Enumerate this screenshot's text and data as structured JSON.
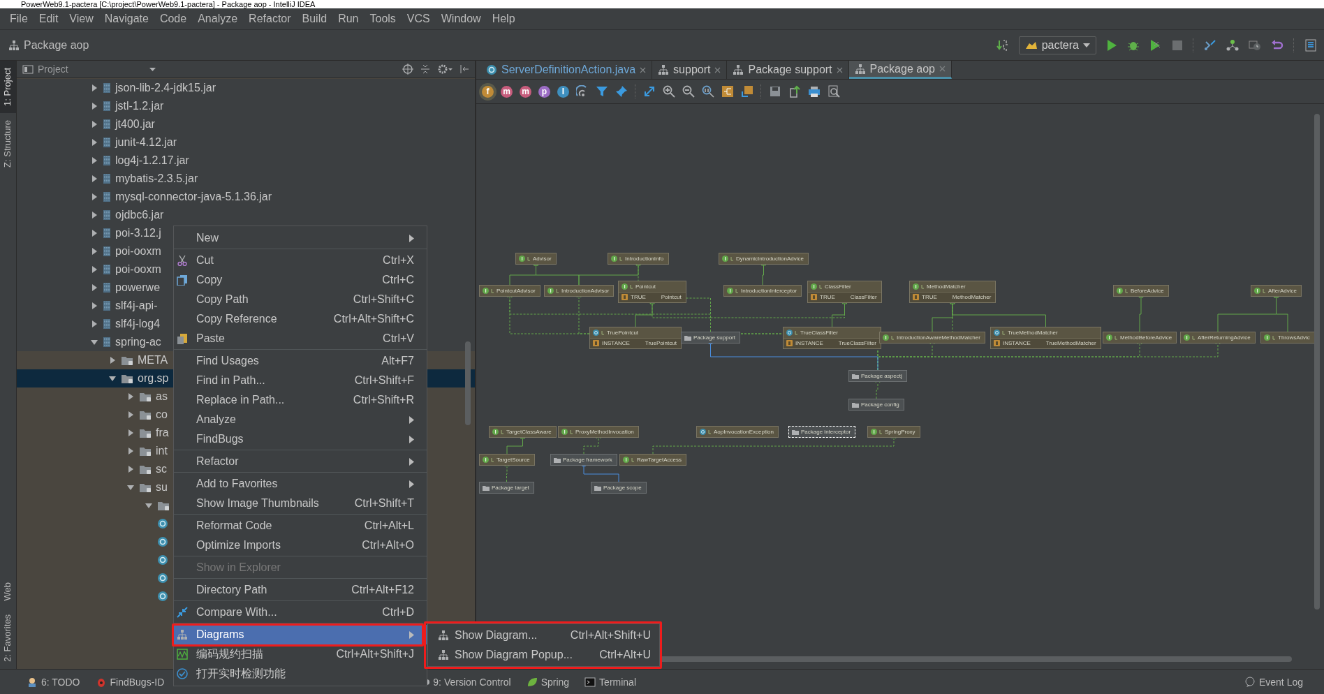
{
  "window": {
    "title": "PowerWeb9.1-pactera [C:\\project\\PowerWeb9.1-pactera] - Package aop - IntelliJ IDEA"
  },
  "menu_bar": [
    "File",
    "Edit",
    "View",
    "Navigate",
    "Code",
    "Analyze",
    "Refactor",
    "Build",
    "Run",
    "Tools",
    "VCS",
    "Window",
    "Help"
  ],
  "nav_bar": {
    "breadcrumb": "Package aop",
    "run_config": "pactera"
  },
  "side_tabs": {
    "top": [
      {
        "label": "1: Project",
        "selected": true
      },
      {
        "label": "Z: Structure",
        "selected": false
      }
    ],
    "bottom": [
      {
        "label": "Web",
        "selected": false
      },
      {
        "label": "2: Favorites",
        "selected": false
      }
    ]
  },
  "project_panel": {
    "title": "Project",
    "tree": [
      {
        "label": "json-lib-2.4-jdk15.jar",
        "kind": "jar",
        "expanded": false,
        "selected": false,
        "tinted": false
      },
      {
        "label": "jstl-1.2.jar",
        "kind": "jar",
        "expanded": false,
        "selected": false,
        "tinted": false
      },
      {
        "label": "jt400.jar",
        "kind": "jar",
        "expanded": false,
        "selected": false,
        "tinted": false
      },
      {
        "label": "junit-4.12.jar",
        "kind": "jar",
        "expanded": false,
        "selected": false,
        "tinted": false
      },
      {
        "label": "log4j-1.2.17.jar",
        "kind": "jar",
        "expanded": false,
        "selected": false,
        "tinted": false
      },
      {
        "label": "mybatis-2.3.5.jar",
        "kind": "jar",
        "expanded": false,
        "selected": false,
        "tinted": false
      },
      {
        "label": "mysql-connector-java-5.1.36.jar",
        "kind": "jar",
        "expanded": false,
        "selected": false,
        "tinted": false
      },
      {
        "label": "ojdbc6.jar",
        "kind": "jar",
        "expanded": false,
        "selected": false,
        "tinted": false
      },
      {
        "label": "poi-3.12.j",
        "kind": "jar",
        "expanded": false,
        "selected": false,
        "tinted": false
      },
      {
        "label": "poi-ooxm",
        "kind": "jar",
        "expanded": false,
        "selected": false,
        "tinted": false
      },
      {
        "label": "poi-ooxm",
        "kind": "jar",
        "expanded": false,
        "selected": false,
        "tinted": false
      },
      {
        "label": "powerwe",
        "kind": "jar",
        "expanded": false,
        "selected": false,
        "tinted": false
      },
      {
        "label": "slf4j-api-",
        "kind": "jar",
        "expanded": false,
        "selected": false,
        "tinted": false
      },
      {
        "label": "slf4j-log4",
        "kind": "jar",
        "expanded": false,
        "selected": false,
        "tinted": false
      },
      {
        "label": "spring-ac",
        "kind": "jar",
        "expanded": true,
        "selected": false,
        "tinted": false,
        "children": [
          {
            "label": "META",
            "kind": "folder",
            "expanded": false,
            "selected": false,
            "tinted": true
          },
          {
            "label": "org.sp",
            "kind": "folder",
            "expanded": true,
            "selected": true,
            "tinted": true,
            "children": [
              {
                "label": "as",
                "kind": "folder",
                "expanded": false,
                "selected": false,
                "tinted": true
              },
              {
                "label": "co",
                "kind": "folder",
                "expanded": false,
                "selected": false,
                "tinted": true
              },
              {
                "label": "fra",
                "kind": "folder",
                "expanded": false,
                "selected": false,
                "tinted": true
              },
              {
                "label": "int",
                "kind": "folder",
                "expanded": false,
                "selected": false,
                "tinted": true
              },
              {
                "label": "sc",
                "kind": "folder",
                "expanded": false,
                "selected": false,
                "tinted": true
              },
              {
                "label": "su",
                "kind": "folder",
                "expanded": true,
                "selected": false,
                "tinted": true,
                "children": [
                  {
                    "kind": "folder",
                    "expanded": true,
                    "selected": false,
                    "tinted": true
                  },
                  {
                    "kind": "class",
                    "selected": false,
                    "tinted": true
                  },
                  {
                    "kind": "class",
                    "selected": false,
                    "tinted": true
                  },
                  {
                    "kind": "class",
                    "selected": false,
                    "tinted": true
                  },
                  {
                    "kind": "class",
                    "selected": false,
                    "tinted": true
                  },
                  {
                    "kind": "class",
                    "selected": false,
                    "tinted": true
                  }
                ]
              }
            ]
          }
        ]
      }
    ]
  },
  "editor_tabs": [
    {
      "label": "ServerDefinitionAction.java",
      "kind": "class",
      "selected": false
    },
    {
      "label": "support",
      "kind": "diagram",
      "selected": false
    },
    {
      "label": "Package support",
      "kind": "diagram",
      "selected": false
    },
    {
      "label": "Package aop",
      "kind": "diagram",
      "selected": true
    }
  ],
  "diagram_toolbar": {
    "badges": [
      {
        "letter": "f",
        "color": "#c08b37",
        "selected": true
      },
      {
        "letter": "m",
        "color": "#c65c7c",
        "selected": false
      },
      {
        "letter": "m",
        "color": "#c65c7c",
        "selected": false
      },
      {
        "letter": "p",
        "color": "#9b6cc4",
        "selected": false
      },
      {
        "letter": "I",
        "color": "#3e8fbf",
        "selected": false
      }
    ]
  },
  "diagram": {
    "nodes": [
      {
        "name": "Advisor",
        "kind": "interface",
        "selected": false
      },
      {
        "name": "IntroductionInfo",
        "kind": "interface",
        "selected": false
      },
      {
        "name": "DynamicIntroductionAdvice",
        "kind": "interface",
        "selected": false
      },
      {
        "name": "PointcutAdvisor",
        "kind": "interface",
        "selected": false
      },
      {
        "name": "IntroductionAdvisor",
        "kind": "interface",
        "selected": false
      },
      {
        "name": "Pointcut",
        "kind": "interface",
        "selected": false,
        "fields": [
          {
            "name": "TRUE",
            "type": "Pointcut"
          }
        ]
      },
      {
        "name": "IntroductionInterceptor",
        "kind": "interface",
        "selected": false
      },
      {
        "name": "ClassFilter",
        "kind": "interface",
        "selected": false,
        "fields": [
          {
            "name": "TRUE",
            "type": "ClassFilter"
          }
        ]
      },
      {
        "name": "MethodMatcher",
        "kind": "interface",
        "selected": false,
        "fields": [
          {
            "name": "TRUE",
            "type": "MethodMatcher"
          }
        ]
      },
      {
        "name": "BeforeAdvice",
        "kind": "interface",
        "selected": false
      },
      {
        "name": "AfterAdvice",
        "kind": "interface",
        "selected": false
      },
      {
        "name": "TruePointcut",
        "kind": "class",
        "selected": false,
        "fields": [
          {
            "name": "INSTANCE",
            "type": "TruePointcut"
          }
        ]
      },
      {
        "name": "Package support",
        "kind": "package",
        "selected": false
      },
      {
        "name": "TrueClassFilter",
        "kind": "class",
        "selected": false,
        "fields": [
          {
            "name": "INSTANCE",
            "type": "TrueClassFilter"
          }
        ]
      },
      {
        "name": "IntroductionAwareMethodMatcher",
        "kind": "interface",
        "selected": false
      },
      {
        "name": "TrueMethodMatcher",
        "kind": "class",
        "selected": false,
        "fields": [
          {
            "name": "INSTANCE",
            "type": "TrueMethodMatcher"
          }
        ]
      },
      {
        "name": "MethodBeforeAdvice",
        "kind": "interface",
        "selected": false
      },
      {
        "name": "AfterReturningAdvice",
        "kind": "interface",
        "selected": false
      },
      {
        "name": "ThrowsAdvic",
        "kind": "interface",
        "selected": false
      },
      {
        "name": "Package aspectj",
        "kind": "package",
        "selected": false
      },
      {
        "name": "Package config",
        "kind": "package",
        "selected": false
      },
      {
        "name": "TargetClassAware",
        "kind": "interface",
        "selected": false
      },
      {
        "name": "ProxyMethodInvocation",
        "kind": "interface",
        "selected": false
      },
      {
        "name": "AopInvocationException",
        "kind": "class",
        "selected": false
      },
      {
        "name": "Package interceptor",
        "kind": "package",
        "selected": true
      },
      {
        "name": "SpringProxy",
        "kind": "interface",
        "selected": false
      },
      {
        "name": "TargetSource",
        "kind": "interface",
        "selected": false
      },
      {
        "name": "Package framework",
        "kind": "package",
        "selected": false
      },
      {
        "name": "RawTargetAccess",
        "kind": "interface",
        "selected": false
      },
      {
        "name": "Package target",
        "kind": "package",
        "selected": false
      },
      {
        "name": "Package scope",
        "kind": "package",
        "selected": false
      }
    ]
  },
  "context_menu": {
    "groups": [
      [
        {
          "label": "New",
          "kind": "plain",
          "submenu": true,
          "disabled": false,
          "selected": false,
          "callout": false
        }
      ],
      [
        {
          "label": "Cut",
          "shortcut": "Ctrl+X",
          "kind": "cut",
          "submenu": false,
          "disabled": false,
          "selected": false,
          "callout": false
        },
        {
          "label": "Copy",
          "shortcut": "Ctrl+C",
          "kind": "copy",
          "submenu": false,
          "disabled": false,
          "selected": false,
          "callout": false
        },
        {
          "label": "Copy Path",
          "shortcut": "Ctrl+Shift+C",
          "kind": "plain",
          "submenu": false,
          "disabled": false,
          "selected": false,
          "callout": false
        },
        {
          "label": "Copy Reference",
          "shortcut": "Ctrl+Alt+Shift+C",
          "kind": "plain",
          "submenu": false,
          "disabled": false,
          "selected": false,
          "callout": false
        },
        {
          "label": "Paste",
          "shortcut": "Ctrl+V",
          "kind": "paste",
          "submenu": false,
          "disabled": false,
          "selected": false,
          "callout": false
        }
      ],
      [
        {
          "label": "Find Usages",
          "shortcut": "Alt+F7",
          "kind": "plain",
          "submenu": false,
          "disabled": false,
          "selected": false,
          "callout": false
        },
        {
          "label": "Find in Path...",
          "shortcut": "Ctrl+Shift+F",
          "kind": "plain",
          "submenu": false,
          "disabled": false,
          "selected": false,
          "callout": false
        },
        {
          "label": "Replace in Path...",
          "shortcut": "Ctrl+Shift+R",
          "kind": "plain",
          "submenu": false,
          "disabled": false,
          "selected": false,
          "callout": false
        },
        {
          "label": "Analyze",
          "kind": "plain",
          "submenu": true,
          "disabled": false,
          "selected": false,
          "callout": false
        },
        {
          "label": "FindBugs",
          "kind": "plain",
          "submenu": true,
          "disabled": false,
          "selected": false,
          "callout": false
        }
      ],
      [
        {
          "label": "Refactor",
          "kind": "plain",
          "submenu": true,
          "disabled": false,
          "selected": false,
          "callout": false
        }
      ],
      [
        {
          "label": "Add to Favorites",
          "kind": "plain",
          "submenu": true,
          "disabled": false,
          "selected": false,
          "callout": false
        },
        {
          "label": "Show Image Thumbnails",
          "shortcut": "Ctrl+Shift+T",
          "kind": "plain",
          "submenu": false,
          "disabled": false,
          "selected": false,
          "callout": false
        }
      ],
      [
        {
          "label": "Reformat Code",
          "shortcut": "Ctrl+Alt+L",
          "kind": "plain",
          "submenu": false,
          "disabled": false,
          "selected": false,
          "callout": false
        },
        {
          "label": "Optimize Imports",
          "shortcut": "Ctrl+Alt+O",
          "kind": "plain",
          "submenu": false,
          "disabled": false,
          "selected": false,
          "callout": false
        }
      ],
      [
        {
          "label": "Show in Explorer",
          "kind": "plain",
          "submenu": false,
          "disabled": true,
          "selected": false,
          "callout": false
        }
      ],
      [
        {
          "label": "Directory Path",
          "shortcut": "Ctrl+Alt+F12",
          "kind": "plain",
          "submenu": false,
          "disabled": false,
          "selected": false,
          "callout": false
        }
      ],
      [
        {
          "label": "Compare With...",
          "shortcut": "Ctrl+D",
          "kind": "compare",
          "submenu": false,
          "disabled": false,
          "selected": false,
          "callout": false
        }
      ],
      [
        {
          "label": "Diagrams",
          "kind": "diagram",
          "submenu": true,
          "disabled": false,
          "selected": true,
          "callout": true
        },
        {
          "label": "编码规约扫描",
          "shortcut": "Ctrl+Alt+Shift+J",
          "kind": "scan",
          "submenu": false,
          "disabled": false,
          "selected": false,
          "callout": false
        },
        {
          "label": "打开实时检测功能",
          "kind": "check",
          "submenu": false,
          "disabled": false,
          "selected": false,
          "callout": false
        }
      ]
    ]
  },
  "submenu": {
    "callout": true,
    "items": [
      {
        "label": "Show Diagram...",
        "shortcut": "Ctrl+Alt+Shift+U"
      },
      {
        "label": "Show Diagram Popup...",
        "shortcut": "Ctrl+Alt+U"
      }
    ]
  },
  "bottom_bar": {
    "tools": [
      {
        "label": "6: TODO",
        "kind": "todo"
      },
      {
        "label": "FindBugs-ID",
        "kind": "bug"
      },
      {
        "label": "9: Version Control",
        "kind": "vcs"
      },
      {
        "label": "Spring",
        "kind": "spring"
      },
      {
        "label": "Terminal",
        "kind": "terminal"
      }
    ],
    "event_log": "Event Log"
  }
}
